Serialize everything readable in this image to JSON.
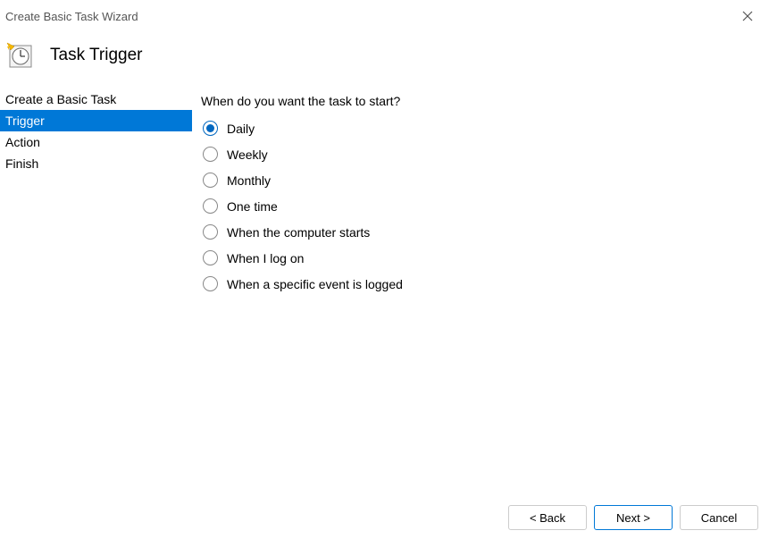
{
  "window": {
    "title": "Create Basic Task Wizard"
  },
  "header": {
    "page_title": "Task Trigger"
  },
  "sidebar": {
    "items": [
      {
        "label": "Create a Basic Task",
        "selected": false
      },
      {
        "label": "Trigger",
        "selected": true
      },
      {
        "label": "Action",
        "selected": false
      },
      {
        "label": "Finish",
        "selected": false
      }
    ]
  },
  "main": {
    "prompt": "When do you want the task to start?",
    "options": [
      {
        "label": "Daily",
        "checked": true
      },
      {
        "label": "Weekly",
        "checked": false
      },
      {
        "label": "Monthly",
        "checked": false
      },
      {
        "label": "One time",
        "checked": false
      },
      {
        "label": "When the computer starts",
        "checked": false
      },
      {
        "label": "When I log on",
        "checked": false
      },
      {
        "label": "When a specific event is logged",
        "checked": false
      }
    ]
  },
  "footer": {
    "back": "< Back",
    "next": "Next >",
    "cancel": "Cancel"
  }
}
